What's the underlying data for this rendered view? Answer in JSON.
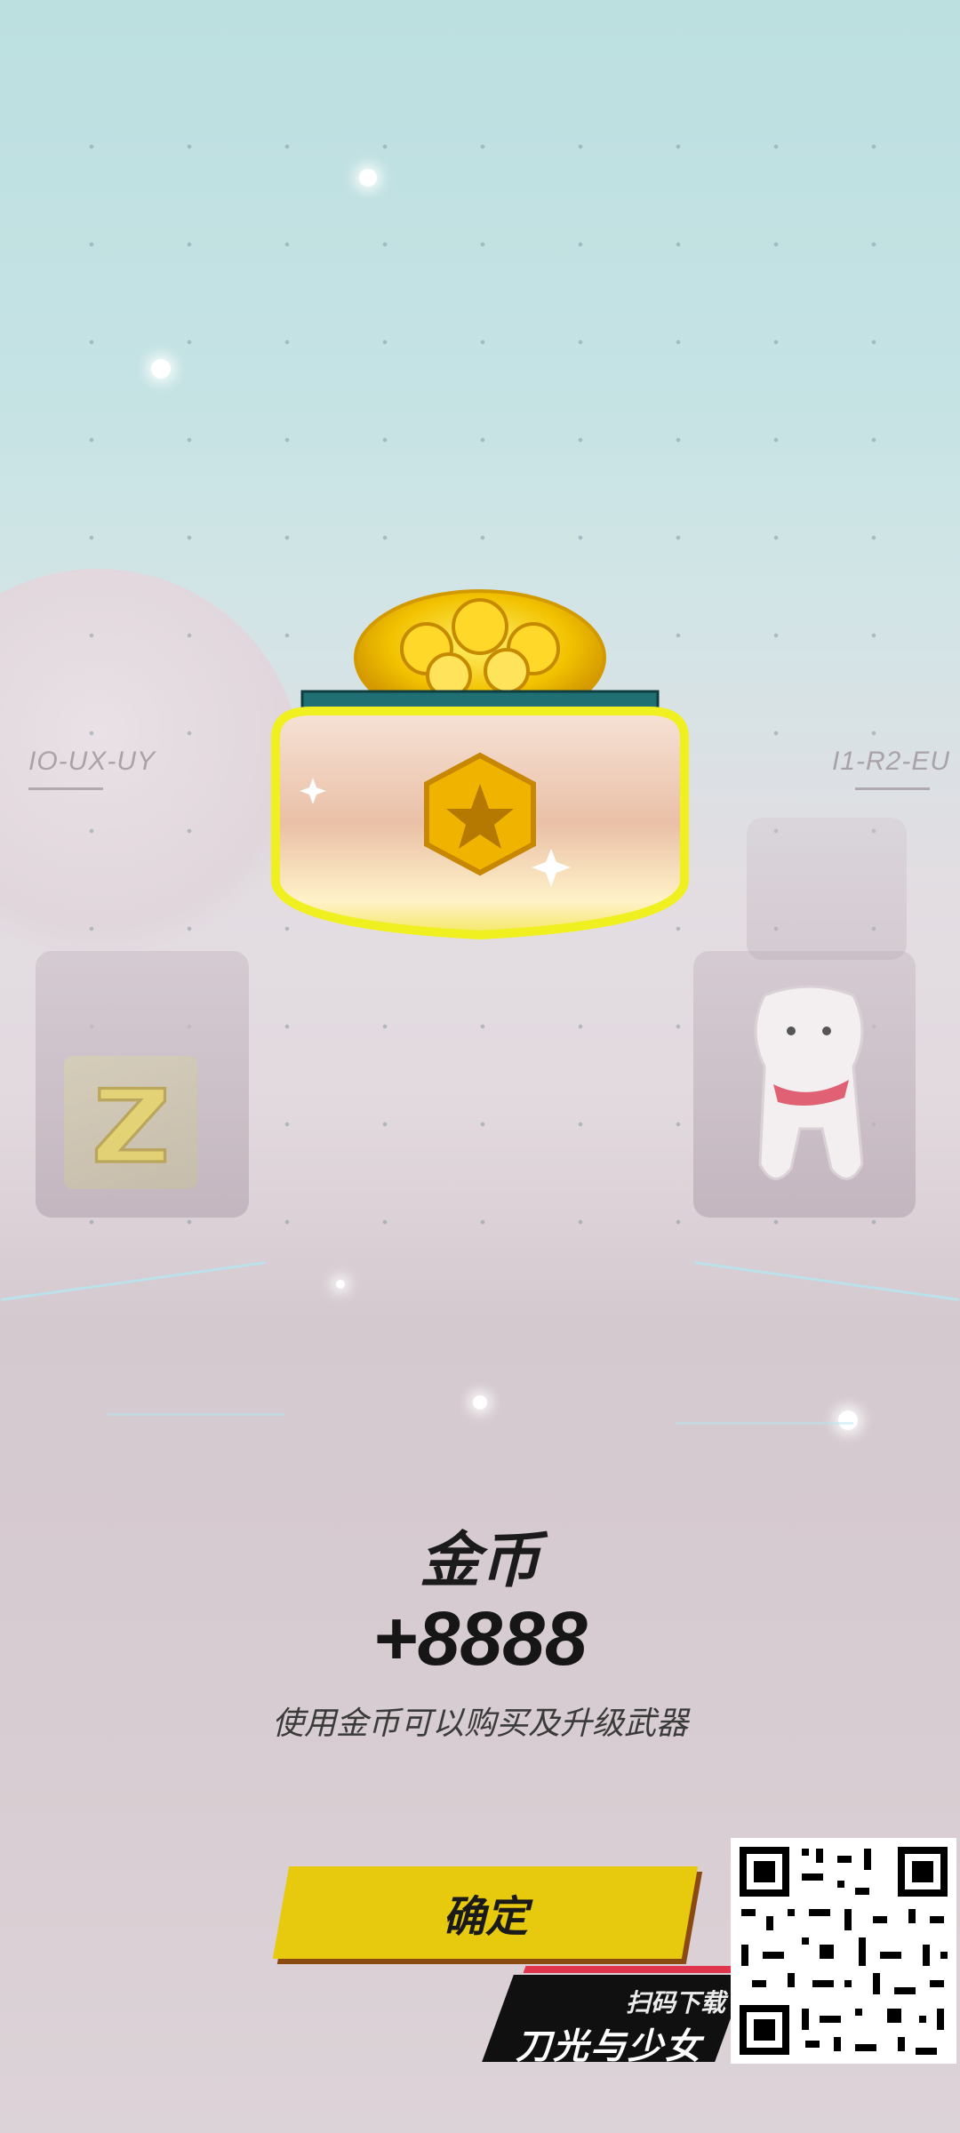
{
  "map_codes": {
    "left": "IO-UX-UY",
    "right": "I1-R2-EU"
  },
  "reward": {
    "title": "金币",
    "amount": "+8888",
    "description": "使用金币可以购买及升级武器"
  },
  "confirm_button_label": "确定",
  "download_banner": {
    "subtitle": "扫码下载",
    "game_name": "刀光与少女"
  },
  "icons": {
    "chest": "coin-chest-icon",
    "star_emblem": "star-hexagon-icon",
    "z_badge": "z-letter-icon",
    "qr": "qr-code-icon"
  },
  "colors": {
    "button": "#e7c90e",
    "button_shadow": "#8a4a12",
    "gold": "#f2c200",
    "banner_bg": "#101010",
    "banner_accent": "#e0344d"
  }
}
